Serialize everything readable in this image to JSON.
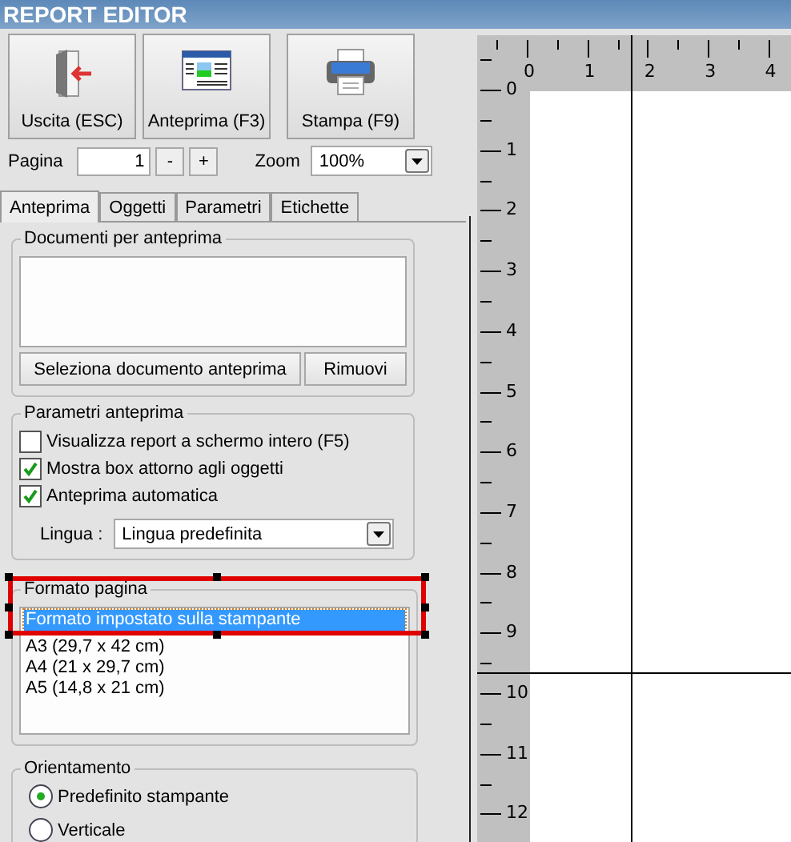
{
  "window": {
    "title": "REPORT EDITOR"
  },
  "toolbar": [
    {
      "label": "Uscita (ESC)",
      "kind": "exit"
    },
    {
      "label": "Anteprima (F3)",
      "kind": "preview"
    },
    {
      "label": "Stampa (F9)",
      "kind": "print"
    }
  ],
  "pager": {
    "label": "Pagina",
    "value": "1",
    "minus": "-",
    "plus": "+",
    "zoom_label": "Zoom",
    "zoom_value": "100%"
  },
  "tabs": [
    {
      "label": "Anteprima",
      "selected": true
    },
    {
      "label": "Oggetti",
      "selected": false
    },
    {
      "label": "Parametri",
      "selected": false
    },
    {
      "label": "Etichette",
      "selected": false
    }
  ],
  "documents": {
    "title": "Documenti per anteprima",
    "buttons": [
      "Seleziona documento anteprima",
      "Rimuovi"
    ]
  },
  "preview_params": {
    "title": "Parametri anteprima",
    "options": [
      {
        "label": "Visualizza report a schermo intero (F5)",
        "checked": false
      },
      {
        "label": "Mostra box attorno agli oggetti",
        "checked": true
      },
      {
        "label": "Anteprima automatica",
        "checked": true
      }
    ],
    "language_label": "Lingua :",
    "language_value": "Lingua predefinita"
  },
  "page_format": {
    "title": "Formato pagina",
    "highlighted": true,
    "items": [
      {
        "label": "Formato impostato sulla stampante",
        "selected": true
      },
      {
        "label": "A3 (29,7 x 42 cm)",
        "selected": false
      },
      {
        "label": "A4 (21 x 29,7 cm)",
        "selected": false
      },
      {
        "label": "A5 (14,8 x 21 cm)",
        "selected": false
      }
    ]
  },
  "orientation": {
    "title": "Orientamento",
    "options": [
      {
        "label": "Predefinito stampante",
        "selected": true
      },
      {
        "label": "Verticale",
        "selected": false
      }
    ]
  },
  "ruler": {
    "horizontal": [
      "0",
      "1",
      "2",
      "3",
      "4"
    ],
    "vertical": [
      "0",
      "1",
      "2",
      "3",
      "4",
      "5",
      "6",
      "7",
      "8",
      "9",
      "10",
      "11",
      "12"
    ]
  }
}
